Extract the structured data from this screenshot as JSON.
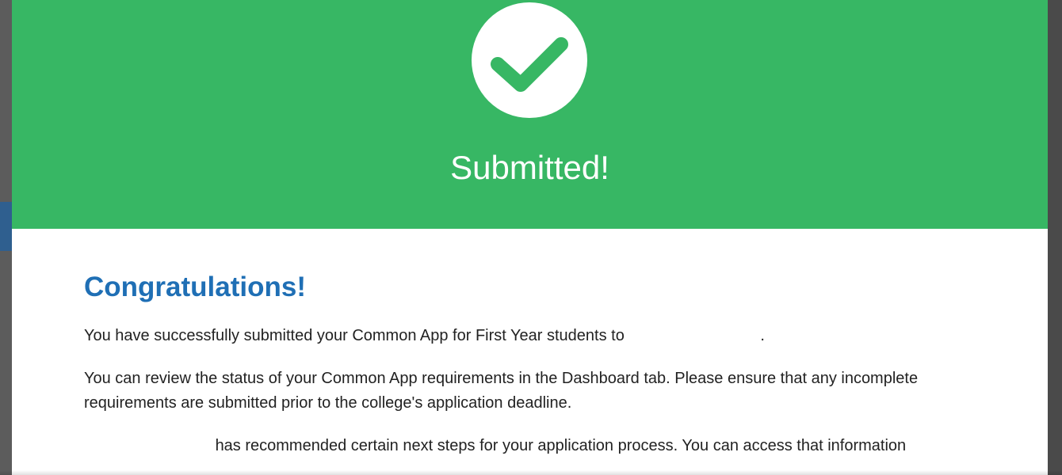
{
  "modal": {
    "hero": {
      "icon": "checkmark-icon",
      "title": "Submitted!",
      "background_color": "#37b764"
    },
    "heading": "Congratulations!",
    "heading_color": "#1f6fb5",
    "paragraphs": [
      {
        "text": "You have successfully submitted your Common App for First Year students to ",
        "suffix": "."
      },
      {
        "text": "You can review the status of your Common App requirements in the Dashboard tab. Please ensure that any incomplete requirements are submitted prior to the college's application deadline."
      },
      {
        "text": "has recommended certain next steps for your application process. You can access that information"
      }
    ]
  }
}
